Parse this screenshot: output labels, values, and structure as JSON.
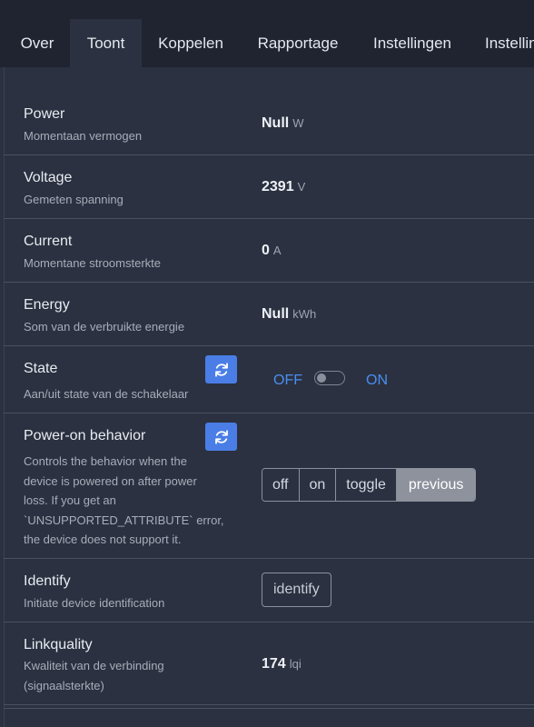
{
  "tabs": [
    "Over",
    "Toont",
    "Koppelen",
    "Rapportage",
    "Instellingen",
    "Instellin"
  ],
  "active_tab": "Toont",
  "exposes": {
    "power": {
      "name": "Power",
      "desc": "Momentaan vermogen",
      "value": "Null",
      "unit": "W"
    },
    "voltage": {
      "name": "Voltage",
      "desc": "Gemeten spanning",
      "value": "2391",
      "unit": "V"
    },
    "current": {
      "name": "Current",
      "desc": "Momentane stroomsterkte",
      "value": "0",
      "unit": "A"
    },
    "energy": {
      "name": "Energy",
      "desc": "Som van de verbruikte energie",
      "value": "Null",
      "unit": "kWh"
    },
    "state": {
      "name": "State",
      "desc": "Aan/uit state van de schakelaar",
      "off_label": "OFF",
      "on_label": "ON",
      "value": "OFF"
    },
    "power_on_behavior": {
      "name": "Power-on behavior",
      "desc_lines": [
        "Controls the behavior when the",
        "device is powered on after power",
        "loss. If you get an",
        "`UNSUPPORTED_ATTRIBUTE` error,",
        "the device does not support it."
      ],
      "options": [
        "off",
        "on",
        "toggle",
        "previous"
      ],
      "selected": "previous"
    },
    "identify": {
      "name": "Identify",
      "desc": "Initiate device identification",
      "button_label": "identify"
    },
    "linkquality": {
      "name": "Linkquality",
      "desc_lines": [
        "Kwaliteit van de verbinding",
        "(signaalsterkte)"
      ],
      "value": "174",
      "unit": "lqi"
    }
  },
  "icons": {
    "refresh": "refresh-icon"
  },
  "colors": {
    "accent": "#4a7ee6",
    "background": "#2b3140",
    "tabbar": "#1f2430"
  }
}
